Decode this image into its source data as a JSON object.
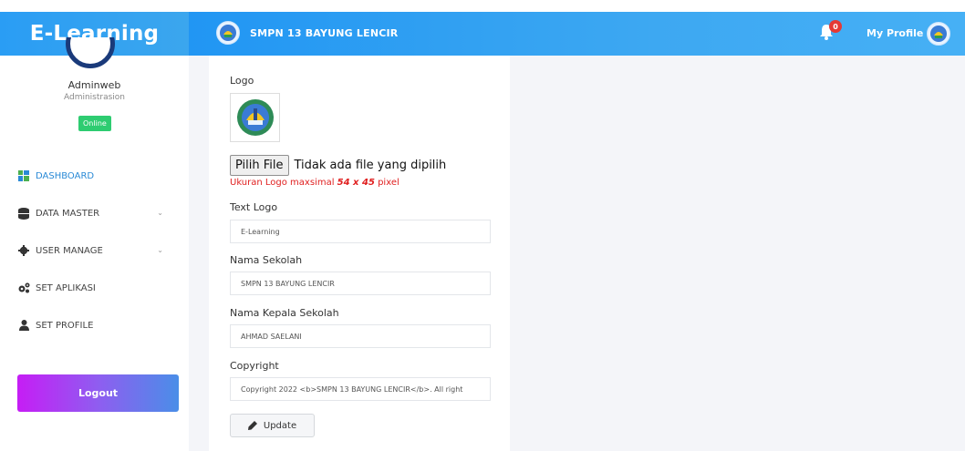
{
  "app": {
    "brand": "E-Learning",
    "school_name": "SMPN 13 BAYUNG LENCIR",
    "notification_count": "0",
    "profile_label": "My Profile"
  },
  "sidebar": {
    "user_name": "Adminweb",
    "user_role": "Administrasion",
    "status": "Online",
    "items": [
      {
        "label": "DASHBOARD",
        "icon": "dashboard-icon"
      },
      {
        "label": "DATA MASTER",
        "icon": "database-icon"
      },
      {
        "label": "USER MANAGE",
        "icon": "gear-icon"
      },
      {
        "label": "SET APLIKASI",
        "icon": "gears-icon"
      },
      {
        "label": "SET PROFILE",
        "icon": "user-icon"
      }
    ],
    "logout_label": "Logout"
  },
  "form": {
    "logo_label": "Logo",
    "file_button": "Pilih File",
    "file_status": "Tidak ada file yang dipilih",
    "hint_prefix": "Ukuran Logo maxsimal ",
    "hint_size": "54 x 45",
    "hint_suffix": " pixel",
    "text_logo_label": "Text Logo",
    "text_logo_value": "E-Learning",
    "nama_sekolah_label": "Nama Sekolah",
    "nama_sekolah_value": "SMPN 13 BAYUNG LENCIR",
    "kepala_label": "Nama Kepala Sekolah",
    "kepala_value": "AHMAD SAELANI",
    "copyright_label": "Copyright",
    "copyright_value": "Copyright  2022 <b>SMPN 13 BAYUNG LENCIR</b>. All right",
    "update_label": "Update"
  },
  "colors": {
    "navbar": "#2196f3",
    "active_menu": "#2a8ad6",
    "online": "#2ecc71",
    "hint": "#e02020",
    "badge": "#e53935"
  }
}
